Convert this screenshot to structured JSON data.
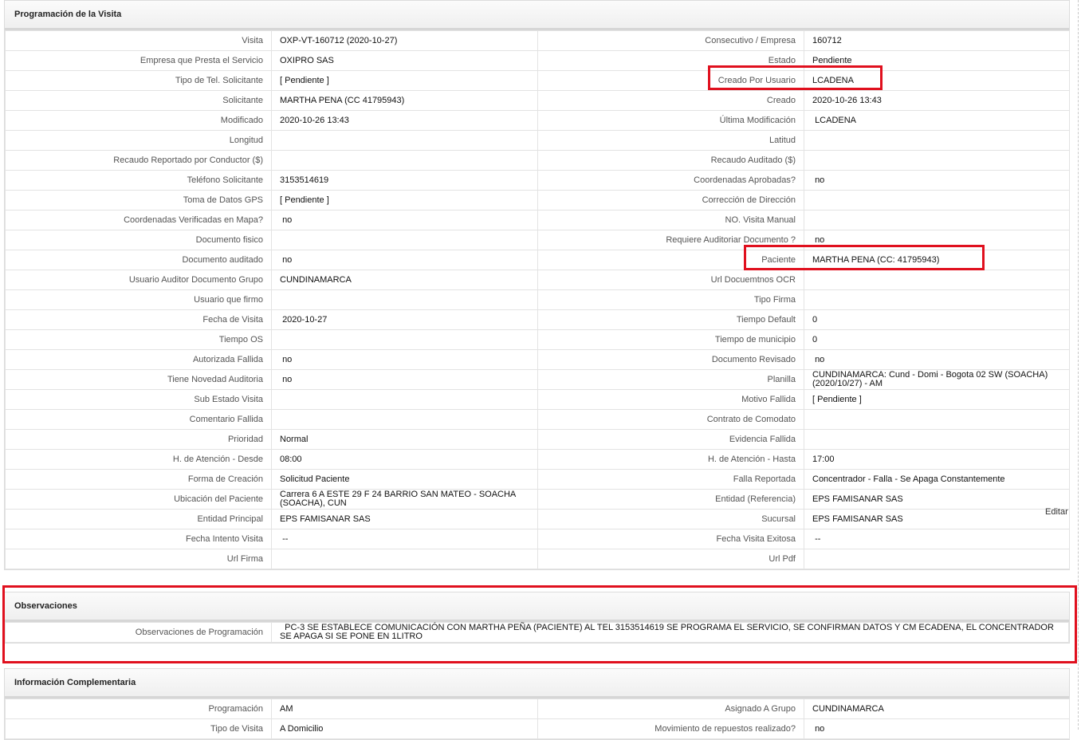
{
  "sections": {
    "programacion": {
      "title": "Programación de la Visita",
      "rows": [
        {
          "l1": "Visita",
          "v1": "OXP-VT-160712 (2020-10-27)",
          "l2": "Consecutivo / Empresa",
          "v2": "160712"
        },
        {
          "l1": "Empresa que Presta el Servicio",
          "v1": "OXIPRO SAS",
          "l2": "Estado",
          "v2": "Pendiente"
        },
        {
          "l1": "Tipo de Tel. Solicitante",
          "v1": "[ Pendiente ]",
          "l2": "Creado Por Usuario",
          "v2": "LCADENA"
        },
        {
          "l1": "Solicitante",
          "v1": "MARTHA PENA (CC 41795943)",
          "l2": "Creado",
          "v2": "2020-10-26 13:43"
        },
        {
          "l1": "Modificado",
          "v1": "2020-10-26 13:43",
          "l2": "Última Modificación",
          "v2": " LCADENA"
        },
        {
          "l1": "Longitud",
          "v1": "",
          "l2": "Latitud",
          "v2": ""
        },
        {
          "l1": "Recaudo Reportado por Conductor ($)",
          "v1": "",
          "l2": "Recaudo Auditado ($)",
          "v2": ""
        },
        {
          "l1": "Teléfono Solicitante",
          "v1": "3153514619",
          "l2": "Coordenadas Aprobadas?",
          "v2": " no"
        },
        {
          "l1": "Toma de Datos GPS",
          "v1": "[ Pendiente ]",
          "l2": "Corrección de Dirección",
          "v2": ""
        },
        {
          "l1": "Coordenadas Verificadas en Mapa?",
          "v1": " no",
          "l2": "NO. Visita Manual",
          "v2": ""
        },
        {
          "l1": "Documento fisico",
          "v1": "",
          "l2": "Requiere Auditoriar Documento ?",
          "v2": " no"
        },
        {
          "l1": "Documento auditado",
          "v1": " no",
          "l2": "Paciente",
          "v2": "MARTHA PENA (CC: 41795943)"
        },
        {
          "l1": "Usuario Auditor Documento Grupo",
          "v1": "CUNDINAMARCA",
          "l2": "Url Docuemtnos OCR",
          "v2": ""
        },
        {
          "l1": "Usuario que firmo",
          "v1": "",
          "l2": "Tipo Firma",
          "v2": ""
        },
        {
          "l1": "Fecha de Visita",
          "v1": " 2020-10-27",
          "l2": "Tiempo Default",
          "v2": "0"
        },
        {
          "l1": "Tiempo OS",
          "v1": "",
          "l2": "Tiempo de municipio",
          "v2": "0"
        },
        {
          "l1": "Autorizada Fallida",
          "v1": " no",
          "l2": "Documento Revisado",
          "v2": " no"
        },
        {
          "l1": "Tiene Novedad Auditoria",
          "v1": " no",
          "l2": "Planilla",
          "v2": "CUNDINAMARCA: Cund - Domi - Bogota 02 SW (SOACHA) (2020/10/27) - AM"
        },
        {
          "l1": "Sub Estado Visita",
          "v1": "",
          "l2": "Motivo Fallida",
          "v2": "[ Pendiente ]"
        },
        {
          "l1": "Comentario Fallida",
          "v1": "",
          "l2": "Contrato de Comodato",
          "v2": ""
        },
        {
          "l1": "Prioridad",
          "v1": "Normal",
          "l2": "Evidencia Fallida",
          "v2": ""
        },
        {
          "l1": "H. de Atención - Desde",
          "v1": "08:00",
          "l2": "H. de Atención - Hasta",
          "v2": "17:00"
        },
        {
          "l1": "Forma de Creación",
          "v1": "Solicitud Paciente",
          "l2": "Falla Reportada",
          "v2": "Concentrador - Falla - Se Apaga Constantemente"
        },
        {
          "l1": "Ubicación del Paciente",
          "v1": "Carrera 6 A ESTE 29 F 24 BARRIO SAN MATEO - SOACHA (SOACHA), CUN",
          "l2": "Entidad (Referencia)",
          "v2": "EPS FAMISANAR SAS"
        },
        {
          "l1": "Entidad Principal",
          "v1": "EPS FAMISANAR SAS",
          "l2": "Sucursal",
          "v2": "EPS FAMISANAR SAS"
        },
        {
          "l1": "Fecha Intento Visita",
          "v1": " --",
          "l2": "Fecha Visita Exitosa",
          "v2": " --"
        },
        {
          "l1": "Url Firma",
          "v1": "",
          "l2": "Url Pdf",
          "v2": ""
        }
      ],
      "edit_label": "Editar"
    },
    "observaciones": {
      "title": "Observaciones",
      "label": "Observaciones de Programación",
      "value": "  PC-3 SE ESTABLECE COMUNICACIÓN CON MARTHA PEÑA (PACIENTE) AL TEL 3153514619 SE PROGRAMA EL SERVICIO, SE CONFIRMAN DATOS Y CM ECADENA, EL CONCENTRADOR SE APAGA SI SE PONE EN 1LITRO"
    },
    "complementaria": {
      "title": "Información Complementaria",
      "rows": [
        {
          "l1": "Programación",
          "v1": "AM",
          "l2": "Asignado A Grupo",
          "v2": "CUNDINAMARCA"
        },
        {
          "l1": "Tipo de Visita",
          "v1": "A Domicilio",
          "l2": "Movimiento de repuestos realizado?",
          "v2": " no"
        }
      ]
    }
  },
  "highlight_color": "#e0101e"
}
